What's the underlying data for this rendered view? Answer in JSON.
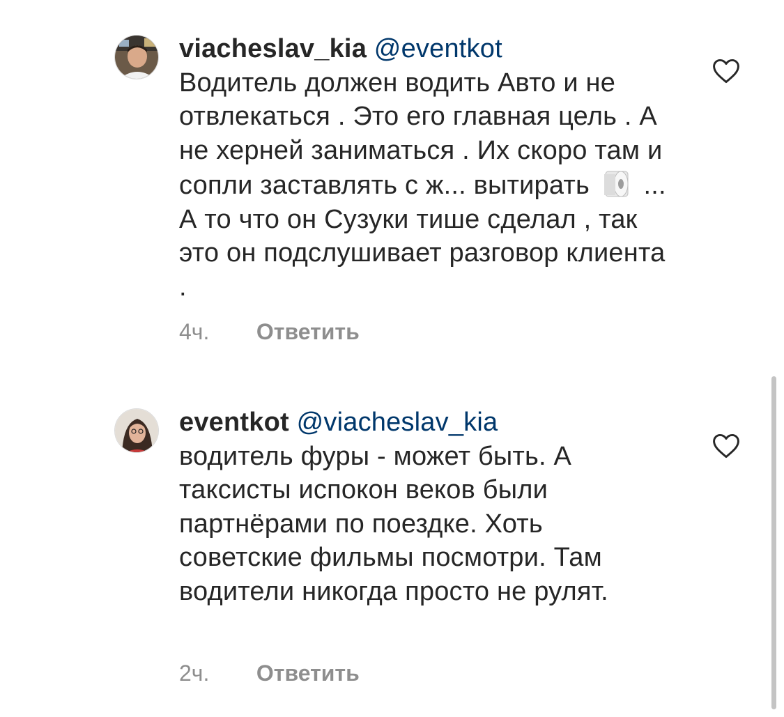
{
  "comments": [
    {
      "username": "viacheslav_kia",
      "mention": "@eventkot",
      "text_before_emoji": "Водитель должен водить Авто и не отвлекаться . Это его главная цель .  А не херней заниматься . Их скоро там и сопли заставлять с ж... вытирать",
      "emoji": "toilet-paper-emoji",
      "text_after_emoji": "... А то что он Сузуки тише сделал , так это он подслушивает разговор клиента .",
      "time": "4ч.",
      "reply_label": "Ответить"
    },
    {
      "username": "eventkot",
      "mention": "@viacheslav_kia",
      "text": "водитель фуры - может быть. А таксисты испокон веков были партнёрами по поездке. Хоть советские фильмы посмотри. Там водители никогда просто не рулят.",
      "time": "2ч.",
      "reply_label": "Ответить"
    }
  ],
  "icons": {
    "like": "heart-outline-icon"
  },
  "colors": {
    "mention": "#00376b",
    "text": "#262626",
    "secondary": "#8e8e8e"
  }
}
